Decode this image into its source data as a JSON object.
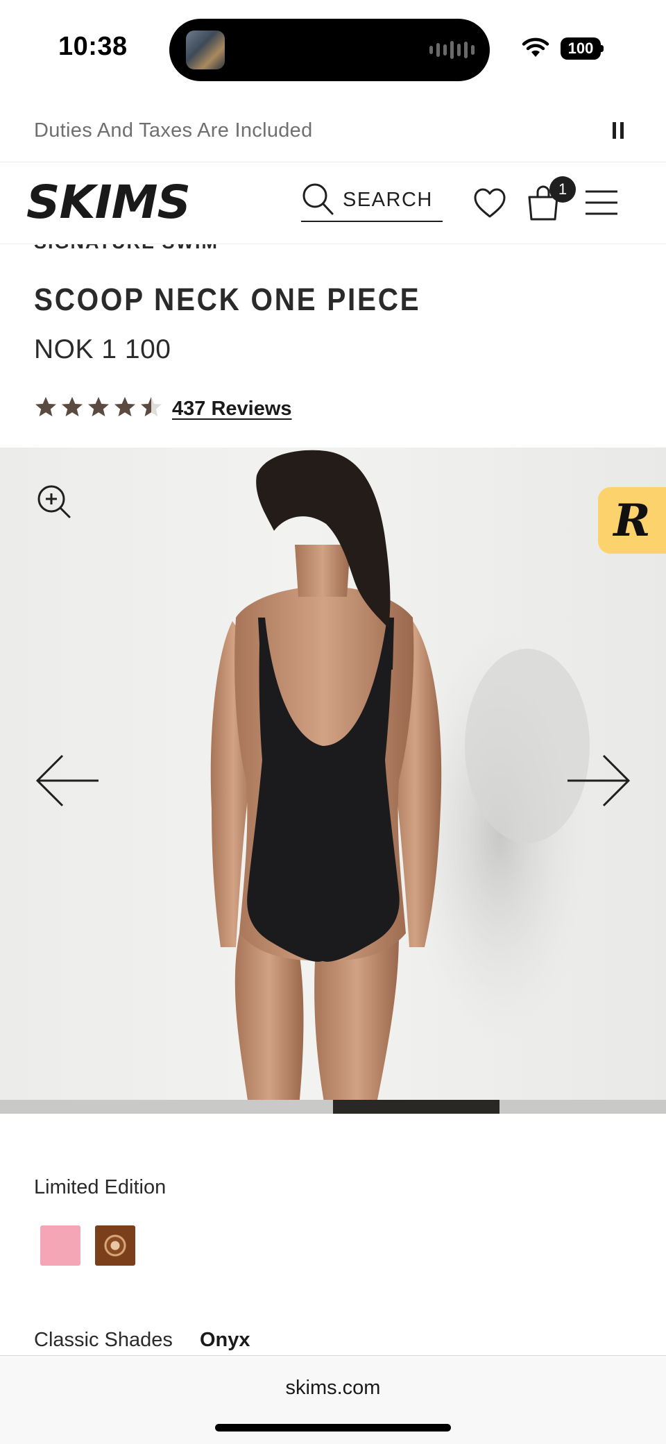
{
  "status_bar": {
    "time": "10:38",
    "battery": "100",
    "icons": [
      "now-playing-art",
      "audio-waveform-icon",
      "wifi-icon",
      "battery-icon"
    ]
  },
  "announcement": {
    "text": "Duties And Taxes Are Included",
    "pause_icon": "pause-icon"
  },
  "header": {
    "logo_text": "SKIMS",
    "search_label": "SEARCH",
    "cart_count": "1",
    "icons": [
      "search-icon",
      "heart-icon",
      "bag-icon",
      "menu-icon"
    ]
  },
  "product": {
    "collection": "SIGNATURE SWIM",
    "title": "SCOOP NECK ONE PIECE",
    "price": "NOK 1 100",
    "rating": 4.5,
    "rating_max": 5,
    "reviews_label": "437 Reviews",
    "star_color": "#5a4a42"
  },
  "gallery": {
    "image_description": "model wearing black scoop back one piece swimsuit",
    "current_slide_fraction_start": 0.5,
    "current_slide_fraction_end": 0.75,
    "icons": [
      "zoom-in-icon",
      "arrow-left-icon",
      "arrow-right-icon"
    ]
  },
  "reward_badge": {
    "letter": "R",
    "color": "#fbd26c"
  },
  "colors": {
    "limited_label": "Limited Edition",
    "limited_swatches": [
      {
        "name": "pink",
        "color": "#f5a6b6"
      },
      {
        "name": "paisley",
        "color": "#8a4a22"
      }
    ],
    "classic_label": "Classic Shades",
    "classic_selected": "Onyx"
  },
  "browser": {
    "url": "skims.com"
  }
}
